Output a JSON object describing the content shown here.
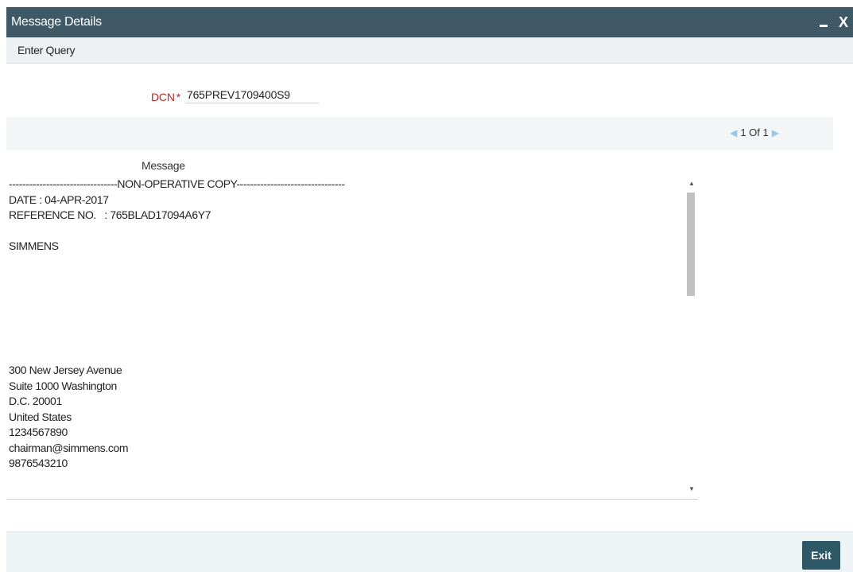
{
  "window": {
    "title": "Message Details",
    "minimize_glyph": "-",
    "close_glyph": "X"
  },
  "menu": {
    "enter_query": "Enter Query"
  },
  "form": {
    "dcn_label": "DCN",
    "required_mark": "*",
    "dcn_value": "765PREV1709400S9"
  },
  "pager": {
    "prev_icon": "triangle-left-icon",
    "text": "1 Of 1",
    "next_icon": "triangle-right-icon"
  },
  "message": {
    "header": "Message",
    "text": "--------------------------------NON-OPERATIVE COPY--------------------------------\nDATE : 04-APR-2017\nREFERENCE NO.   : 765BLAD17094A6Y7\n\nSIMMENS\n\n\n\n\n\n\n\n300 New Jersey Avenue\nSuite 1000 Washington\nD.C. 20001\nUnited States\n1234567890\nchairman@simmens.com\n9876543210\n\n"
  },
  "footer": {
    "exit_label": "Exit"
  },
  "colors": {
    "titlebar": "#3f5a66",
    "required": "#c0262a",
    "exit_button": "#2f5867",
    "pager_arrow": "#9cc7e3"
  }
}
